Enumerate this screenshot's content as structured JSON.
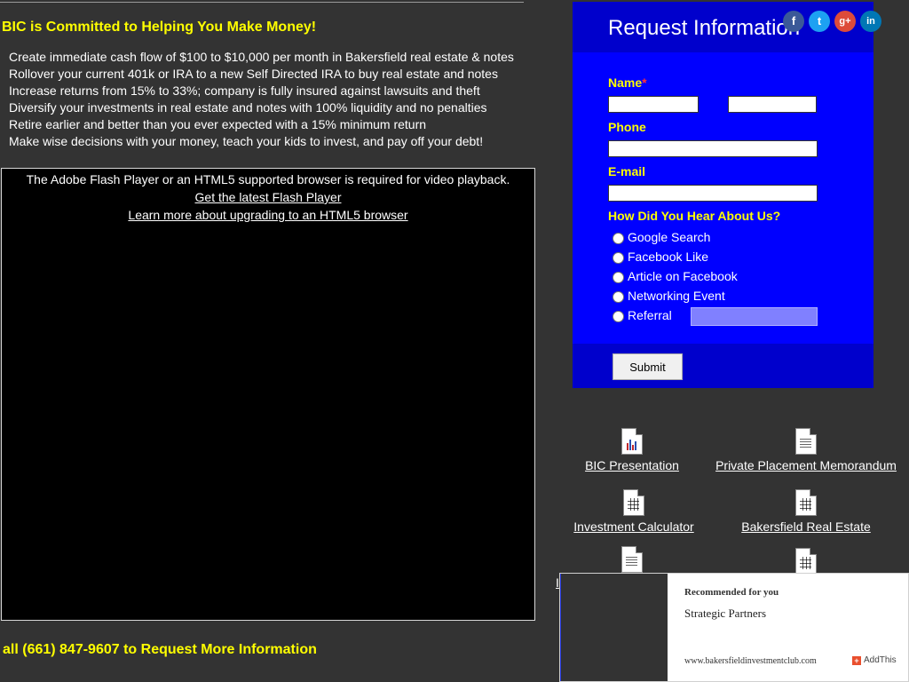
{
  "headline": "BIC is Committed to Helping You Make Money!",
  "benefits": [
    "Create immediate cash flow of $100 to $10,000 per month in Bakersfield real estate & notes",
    "Rollover your current 401k or IRA to a new Self Directed IRA to buy real estate and notes",
    "Increase returns from 15% to 33%; company is fully insured against lawsuits and theft",
    "Diversify your investments in real estate and notes with 100% liquidity and no penalties",
    "Retire earlier and better than you ever expected with a 15% minimum return",
    "Make wise decisions with your money, teach your kids to invest, and pay off your debt!"
  ],
  "video": {
    "message": "The Adobe Flash Player or an HTML5 supported browser is required for video playback.",
    "flash_link": "Get the latest Flash Player",
    "html5_link": "Learn more about upgrading to an HTML5 browser"
  },
  "callout": "all (661) 847-9607 to Request More Information",
  "form": {
    "title": "Request Information",
    "name_label": "Name",
    "required_mark": "*",
    "phone_label": "Phone",
    "email_label": "E-mail",
    "source_label": "How Did You Hear About Us?",
    "options": [
      "Google Search",
      "Facebook Like",
      "Article on Facebook",
      "Networking Event",
      "Referral"
    ],
    "submit": "Submit"
  },
  "social": [
    {
      "icon": "facebook-icon",
      "glyph": "f",
      "color": "#3b5998"
    },
    {
      "icon": "twitter-icon",
      "glyph": "t",
      "color": "#1da1f2"
    },
    {
      "icon": "google-plus-icon",
      "glyph": "g+",
      "color": "#dd4b39"
    },
    {
      "icon": "linkedin-icon",
      "glyph": "in",
      "color": "#0077b5"
    }
  ],
  "documents": [
    {
      "label": "BIC Presentation",
      "icon": "presentation-chart-icon"
    },
    {
      "label": "Private Placement Memorandum",
      "icon": "document-icon"
    },
    {
      "label": "Investment Calculator",
      "icon": "spreadsheet-icon"
    },
    {
      "label": "Bakersfield Real Estate",
      "icon": "spreadsheet-icon"
    },
    {
      "label": "",
      "icon": "document-icon"
    },
    {
      "label": "",
      "icon": "spreadsheet-icon"
    }
  ],
  "peek_text": "I",
  "recommended": {
    "heading": "Recommended for you",
    "title": "Strategic Partners",
    "url": "www.bakersfieldinvestmentclub.com",
    "brand": "AddThis"
  }
}
